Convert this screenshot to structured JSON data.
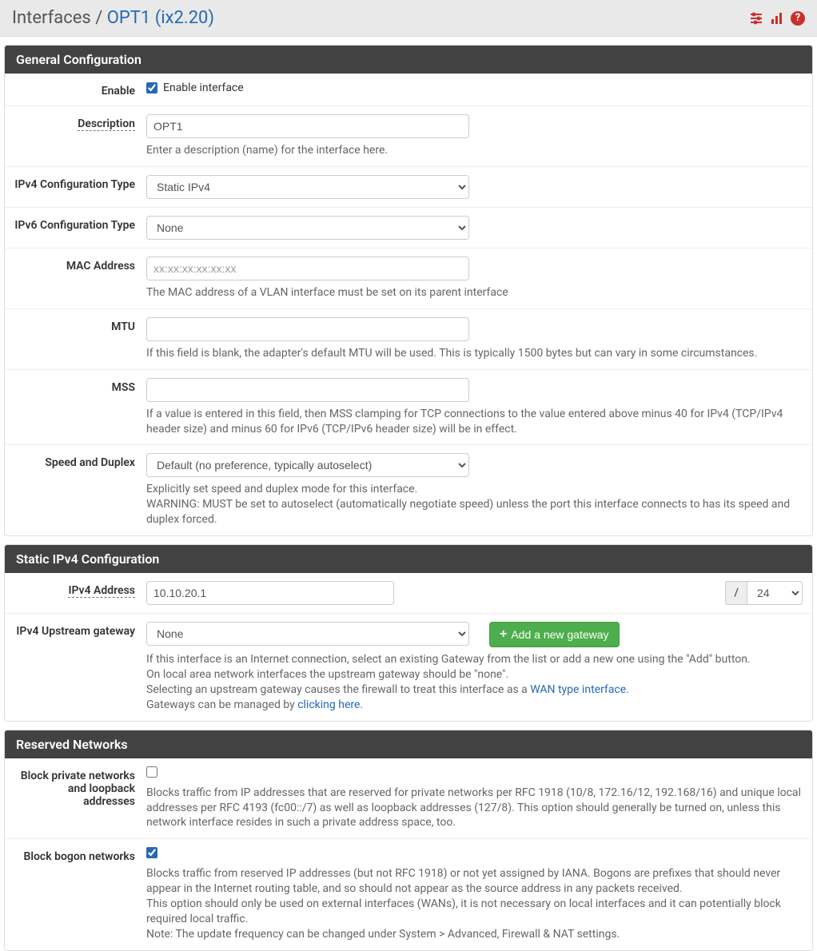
{
  "breadcrumb": {
    "root": "Interfaces",
    "sep": " / ",
    "item": "OPT1 (ix2.20)"
  },
  "panels": {
    "general": {
      "title": "General Configuration",
      "enable": {
        "label": "Enable",
        "checkbox_label": "Enable interface",
        "checked": true
      },
      "description": {
        "label": "Description",
        "value": "OPT1",
        "help": "Enter a description (name) for the interface here."
      },
      "ipv4type": {
        "label": "IPv4 Configuration Type",
        "selected": "Static IPv4"
      },
      "ipv6type": {
        "label": "IPv6 Configuration Type",
        "selected": "None"
      },
      "mac": {
        "label": "MAC Address",
        "placeholder": "xx:xx:xx:xx:xx:xx",
        "help": "The MAC address of a VLAN interface must be set on its parent interface"
      },
      "mtu": {
        "label": "MTU",
        "help": "If this field is blank, the adapter's default MTU will be used. This is typically 1500 bytes but can vary in some circumstances."
      },
      "mss": {
        "label": "MSS",
        "help": "If a value is entered in this field, then MSS clamping for TCP connections to the value entered above minus 40 for IPv4 (TCP/IPv4 header size) and minus 60 for IPv6 (TCP/IPv6 header size) will be in effect."
      },
      "speed": {
        "label": "Speed and Duplex",
        "selected": "Default (no preference, typically autoselect)",
        "help1": "Explicitly set speed and duplex mode for this interface.",
        "help2": "WARNING: MUST be set to autoselect (automatically negotiate speed) unless the port this interface connects to has its speed and duplex forced."
      }
    },
    "static": {
      "title": "Static IPv4 Configuration",
      "address": {
        "label": "IPv4 Address",
        "value": "10.10.20.1",
        "slash": "/",
        "mask": "24"
      },
      "gateway": {
        "label": "IPv4 Upstream gateway",
        "selected": "None",
        "button": "Add a new gateway",
        "help1": "If this interface is an Internet connection, select an existing Gateway from the list or add a new one using the \"Add\" button.",
        "help2": "On local area network interfaces the upstream gateway should be \"none\".",
        "help3a": "Selecting an upstream gateway causes the firewall to treat this interface as a ",
        "help3link": "WAN type interface",
        "help3b": ".",
        "help4a": "Gateways can be managed by ",
        "help4link": "clicking here",
        "help4b": "."
      }
    },
    "reserved": {
      "title": "Reserved Networks",
      "blockpriv": {
        "label": "Block private networks and loopback addresses",
        "checked": false,
        "help": "Blocks traffic from IP addresses that are reserved for private networks per RFC 1918 (10/8, 172.16/12, 192.168/16) and unique local addresses per RFC 4193 (fc00::/7) as well as loopback addresses (127/8). This option should generally be turned on, unless this network interface resides in such a private address space, too."
      },
      "blockbogon": {
        "label": "Block bogon networks",
        "checked": true,
        "help1": "Blocks traffic from reserved IP addresses (but not RFC 1918) or not yet assigned by IANA. Bogons are prefixes that should never appear in the Internet routing table, and so should not appear as the source address in any packets received.",
        "help2": "This option should only be used on external interfaces (WANs), it is not necessary on local interfaces and it can potentially block required local traffic.",
        "help3": "Note: The update frequency can be changed under System > Advanced, Firewall & NAT settings."
      }
    }
  }
}
